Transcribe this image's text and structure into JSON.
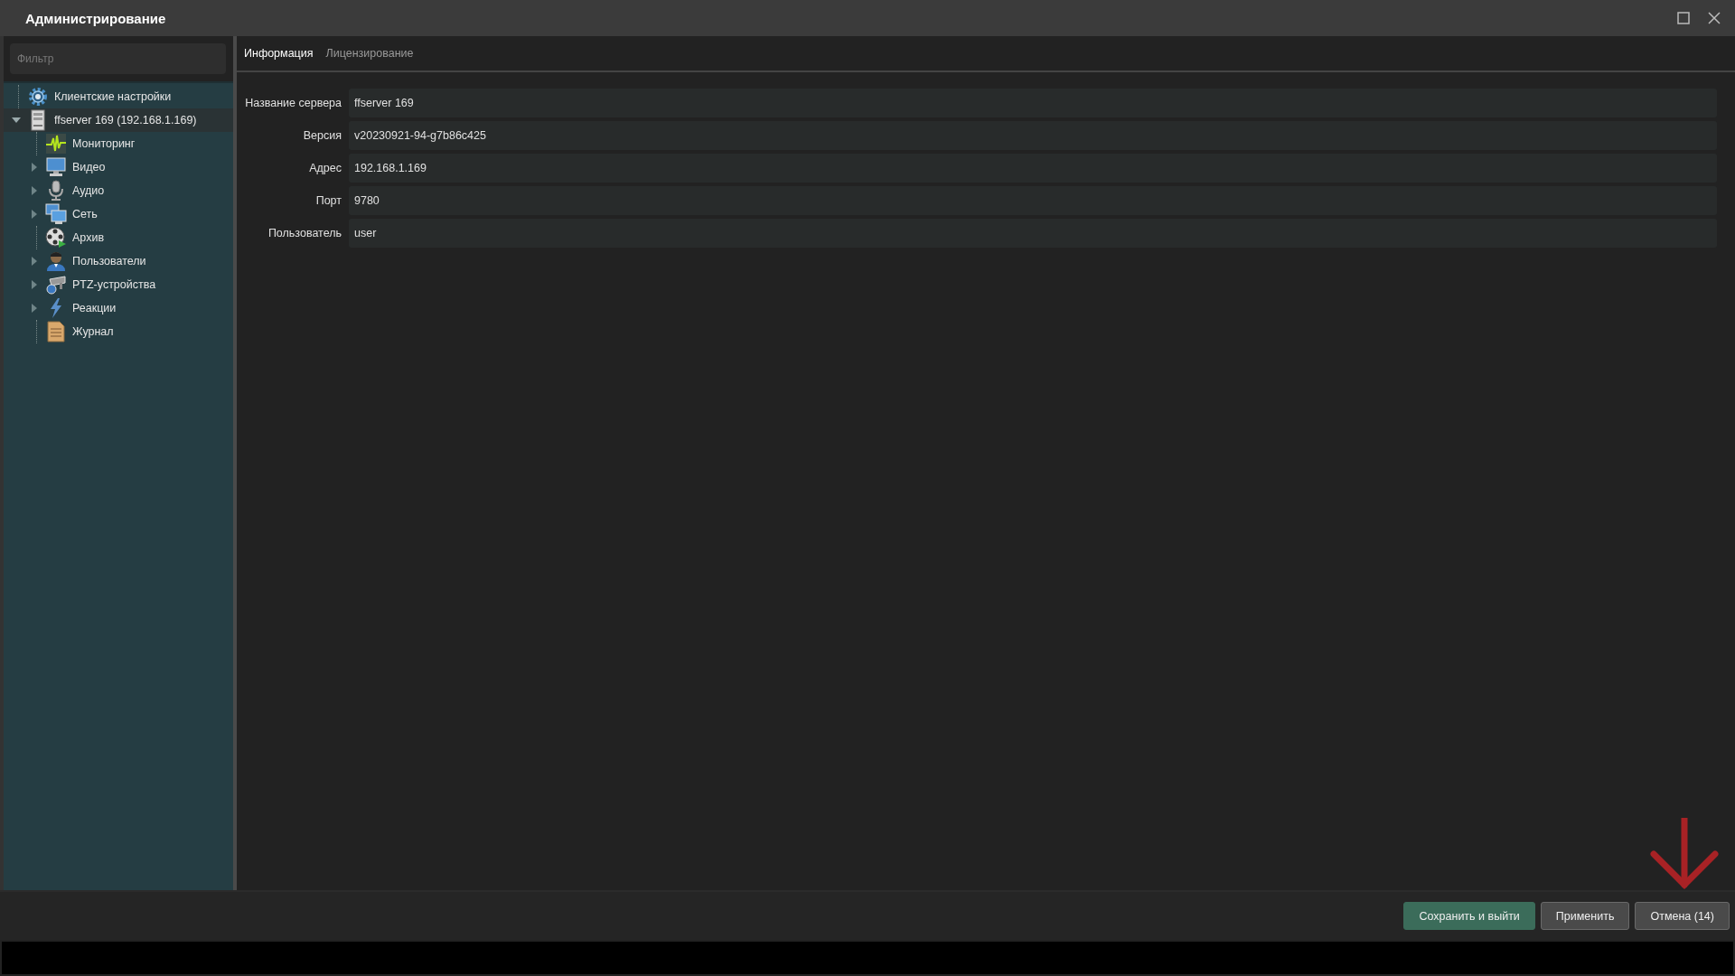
{
  "window": {
    "title": "Администрирование"
  },
  "sidebar": {
    "filter": {
      "placeholder": "Фильтр"
    },
    "tree": [
      {
        "label": "Клиентские настройки",
        "kind": "gear",
        "selected": false
      },
      {
        "label": "ffserver 169 (192.168.1.169)",
        "kind": "server",
        "expanded": true,
        "selected": true,
        "children": [
          {
            "label": "Мониторинг",
            "kind": "monitoring",
            "selected": false
          },
          {
            "label": "Видео",
            "kind": "video",
            "expanded": false,
            "selected": false
          },
          {
            "label": "Аудио",
            "kind": "audio",
            "expanded": false,
            "selected": false
          },
          {
            "label": "Сеть",
            "kind": "network",
            "expanded": false,
            "selected": false
          },
          {
            "label": "Архив",
            "kind": "archive",
            "selected": false
          },
          {
            "label": "Пользователи",
            "kind": "users",
            "expanded": false,
            "selected": false
          },
          {
            "label": "PTZ-устройства",
            "kind": "ptz",
            "expanded": false,
            "selected": false
          },
          {
            "label": "Реакции",
            "kind": "reactions",
            "expanded": false,
            "selected": false
          },
          {
            "label": "Журнал",
            "kind": "journal",
            "selected": false
          }
        ]
      }
    ]
  },
  "tabs": [
    {
      "label": "Информация",
      "selected": true
    },
    {
      "label": "Лицензирование",
      "selected": false
    }
  ],
  "fields": [
    {
      "label": "Название сервера",
      "value": "ffserver 169"
    },
    {
      "label": "Версия",
      "value": "v20230921-94-g7b86c425"
    },
    {
      "label": "Адрес",
      "value": "192.168.1.169"
    },
    {
      "label": "Порт",
      "value": "9780"
    },
    {
      "label": "Пользователь",
      "value": "user"
    }
  ],
  "buttons": [
    {
      "label": "Сохранить и выйти",
      "kind": "primary"
    },
    {
      "label": "Применить",
      "kind": "secondary"
    },
    {
      "label": "Отмена (14)",
      "kind": "secondary"
    }
  ]
}
